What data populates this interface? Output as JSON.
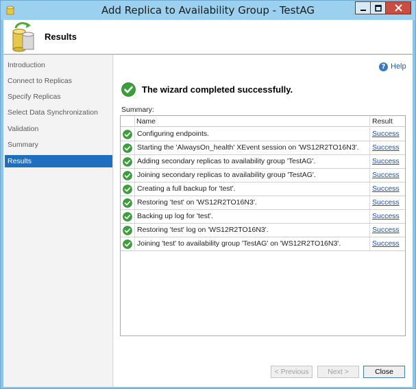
{
  "window": {
    "title": "Add Replica to Availability Group - TestAG"
  },
  "header": {
    "title": "Results"
  },
  "sidebar": {
    "items": [
      {
        "label": "Introduction",
        "active": false
      },
      {
        "label": "Connect to Replicas",
        "active": false
      },
      {
        "label": "Specify Replicas",
        "active": false
      },
      {
        "label": "Select Data Synchronization",
        "active": false
      },
      {
        "label": "Validation",
        "active": false
      },
      {
        "label": "Summary",
        "active": false
      },
      {
        "label": "Results",
        "active": true
      }
    ]
  },
  "help": {
    "label": "Help",
    "icon": "help-icon"
  },
  "banner": {
    "text": "The wizard completed successfully.",
    "icon": "success-check-icon"
  },
  "summary": {
    "label": "Summary:",
    "columns": {
      "name": "Name",
      "result": "Result"
    },
    "rows": [
      {
        "name": "Configuring endpoints.",
        "result": "Success"
      },
      {
        "name": "Starting the 'AlwaysOn_health' XEvent session on 'WS12R2TO16N3'.",
        "result": "Success"
      },
      {
        "name": "Adding secondary replicas to availability group 'TestAG'.",
        "result": "Success"
      },
      {
        "name": "Joining secondary replicas to availability group 'TestAG'.",
        "result": "Success"
      },
      {
        "name": "Creating a full backup for 'test'.",
        "result": "Success"
      },
      {
        "name": "Restoring 'test' on 'WS12R2TO16N3'.",
        "result": "Success"
      },
      {
        "name": "Backing up log for 'test'.",
        "result": "Success"
      },
      {
        "name": "Restoring 'test' log on 'WS12R2TO16N3'.",
        "result": "Success"
      },
      {
        "name": "Joining 'test' to availability group 'TestAG' on 'WS12R2TO16N3'.",
        "result": "Success"
      }
    ]
  },
  "buttons": {
    "previous": "< Previous",
    "next": "Next >",
    "close": "Close"
  },
  "colors": {
    "accent": "#1f6fc0",
    "success": "#3aa13a",
    "titlebar": "#9bd0ef",
    "close": "#c94d40"
  }
}
